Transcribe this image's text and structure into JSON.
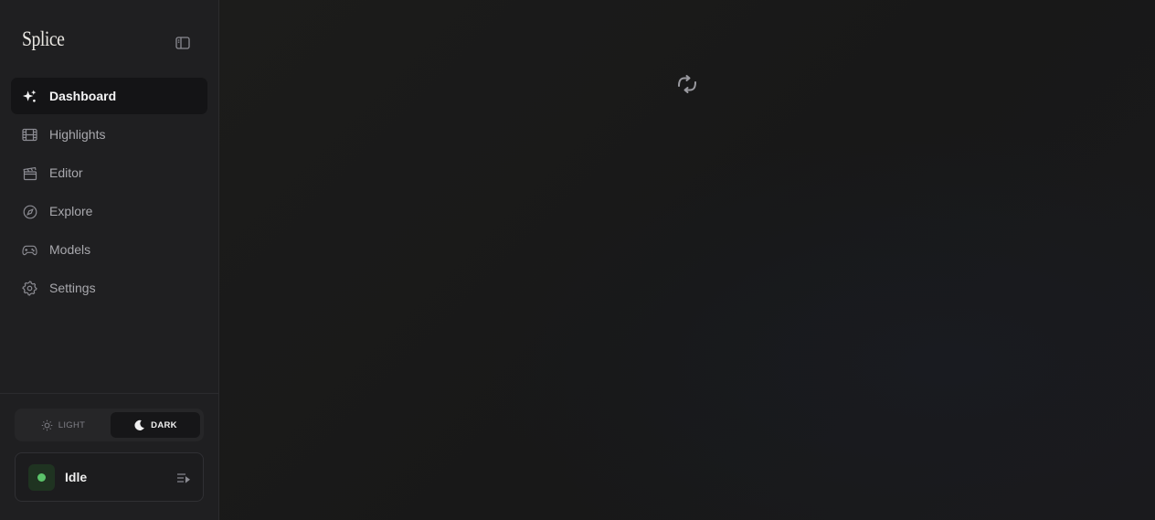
{
  "app": {
    "name": "Splice"
  },
  "sidebar": {
    "collapse_icon": "sidebar-collapse-icon",
    "items": [
      {
        "label": "Dashboard",
        "icon": "sparkles-icon",
        "active": true
      },
      {
        "label": "Highlights",
        "icon": "film-strip-icon",
        "active": false
      },
      {
        "label": "Editor",
        "icon": "clapperboard-icon",
        "active": false
      },
      {
        "label": "Explore",
        "icon": "compass-icon",
        "active": false
      },
      {
        "label": "Models",
        "icon": "gamepad-icon",
        "active": false
      },
      {
        "label": "Settings",
        "icon": "gear-icon",
        "active": false
      }
    ]
  },
  "theme": {
    "light_label": "LIGHT",
    "dark_label": "DARK",
    "selected": "DARK"
  },
  "status": {
    "label": "Idle",
    "color": "#5bc46a",
    "queue_icon": "queue-list-icon"
  },
  "main": {
    "loading_icon": "refresh-spinner-icon"
  },
  "colors": {
    "sidebar_bg": "#1f1f21",
    "main_bg": "#181818",
    "active_item_bg": "#141416",
    "text_primary": "#f3f3f4",
    "text_muted": "#a8a8ad",
    "status_green": "#5bc46a"
  }
}
